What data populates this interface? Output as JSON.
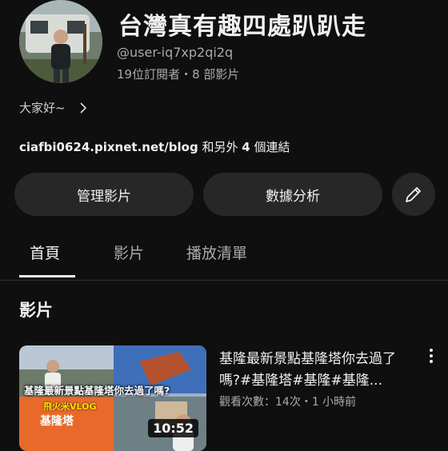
{
  "channel": {
    "name": "台灣真有趣四處趴趴走",
    "handle": "@user-iq7xp2qi2q",
    "stats": "19位訂閱者・8 部影片",
    "description": "大家好~",
    "links": {
      "url": "ciafbi0624.pixnet.net/blog",
      "more_text": " 和另外 ",
      "count": "4",
      "suffix": " 個連結"
    }
  },
  "actions": {
    "manage_label": "管理影片",
    "analytics_label": "數據分析",
    "edit_icon": "pencil-icon"
  },
  "tabs": [
    {
      "label": "首頁",
      "active": true
    },
    {
      "label": "影片",
      "active": false
    },
    {
      "label": "播放清單",
      "active": false
    }
  ],
  "section": {
    "title": "影片"
  },
  "video": {
    "title": "基隆最新景點基隆塔你去過了嗎?#基隆塔#基隆#基隆...",
    "meta": "觀看次數：14次・1 小時前",
    "duration": "10:52",
    "thumb_caption": "基隆最新景點基隆塔你去過了嗎?",
    "thumb_brand": "飛火米VLOG",
    "thumb_sign": "基隆塔"
  },
  "colors": {
    "background": "#0f0f0f",
    "pill": "#272727",
    "text_secondary": "#aaaaaa"
  }
}
